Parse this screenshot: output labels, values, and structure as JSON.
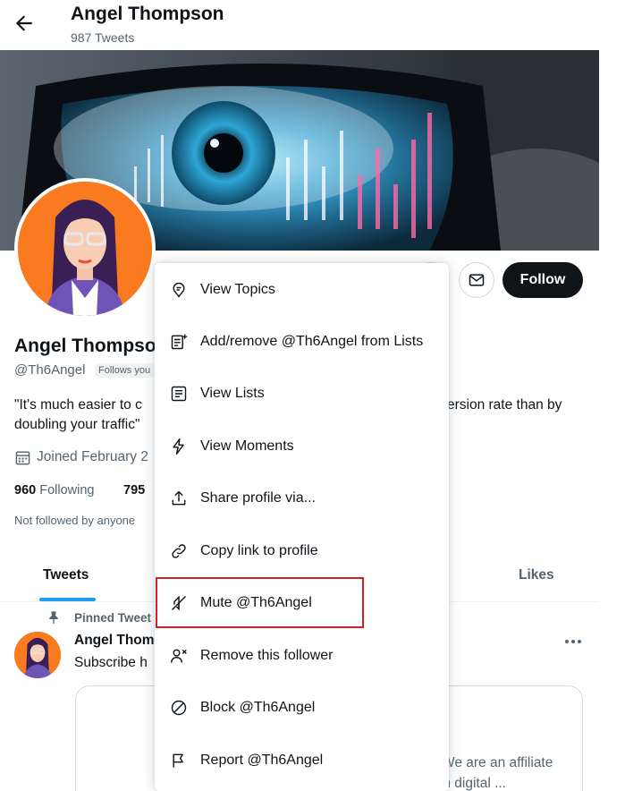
{
  "header": {
    "name": "Angel Thompson",
    "tweet_count": "987 Tweets"
  },
  "profile": {
    "name": "Angel Thompso",
    "handle": "@Th6Angel",
    "follows_you": "Follows you",
    "bio_line1_start": "\"It's much easier to c",
    "bio_line1_end": "ersion rate than by",
    "bio_line2": "doubling your traffic\"",
    "joined": "Joined February 2",
    "following_count": "960",
    "following_label": "Following",
    "followers_count": "795",
    "not_followed": "Not followed by anyone"
  },
  "actions": {
    "follow": "Follow"
  },
  "tabs": [
    {
      "label": "Tweets",
      "active": true
    },
    {
      "label": "Likes",
      "active": false
    }
  ],
  "pinned_tweet": {
    "label": "Pinned Tweet",
    "name": "Angel Thom",
    "text": "Subscribe h",
    "card_line1": "We are an affiliate",
    "card_line2": "marketing channel promoting high-tech digital ..."
  },
  "menu": {
    "items": [
      {
        "label": "View Topics",
        "icon": "topics-icon"
      },
      {
        "label": "Add/remove @Th6Angel from Lists",
        "icon": "list-add-icon"
      },
      {
        "label": "View Lists",
        "icon": "lists-icon"
      },
      {
        "label": "View Moments",
        "icon": "moments-icon"
      },
      {
        "label": "Share profile via...",
        "icon": "share-icon"
      },
      {
        "label": "Copy link to profile",
        "icon": "link-icon"
      },
      {
        "label": "Mute @Th6Angel",
        "icon": "mute-icon",
        "highlighted": true
      },
      {
        "label": "Remove this follower",
        "icon": "remove-follower-icon"
      },
      {
        "label": "Block @Th6Angel",
        "icon": "block-icon"
      },
      {
        "label": "Report @Th6Angel",
        "icon": "report-icon"
      }
    ]
  },
  "colors": {
    "accent": "#1d9bf0",
    "highlight_box": "#d0202a",
    "avatar_bg": "#f97a1f",
    "text_secondary": "#536471"
  }
}
